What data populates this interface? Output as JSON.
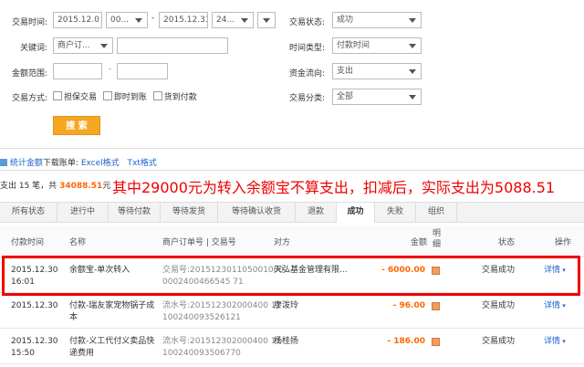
{
  "filters": {
    "time_label": "交易时间:",
    "start_date": "2015.12.0",
    "start_hour": "00...",
    "range_sep": "-",
    "end_date": "2015.12.31",
    "end_hour": "24...",
    "keyword_label": "关键词:",
    "keyword_type": "商户订...",
    "keyword_value": "",
    "amount_label": "金额范围:",
    "amount_from": "",
    "amount_sep": "-",
    "amount_to": "",
    "method_label": "交易方式:",
    "method_options": [
      "担保交易",
      "即时到账",
      "货到付款"
    ],
    "status_label": "交易状态:",
    "status_value": "成功",
    "time_type_label": "时间类型:",
    "time_type_value": "付款时间",
    "fund_flow_label": "资金流向:",
    "fund_flow_value": "支出",
    "category_label": "交易分类:",
    "category_value": "全部",
    "search_button": "搜 索"
  },
  "download": {
    "stats_link": "统计金额",
    "prefix": "下载账单:",
    "excel": "Excel格式",
    "txt": "Txt格式"
  },
  "summary": {
    "prefix": "支出 15 笔，共",
    "amount": "34088.51",
    "unit": "元",
    "annotation": "其中29000元为转入余额宝不算支出，扣减后，实际支出为5088.51"
  },
  "tabs": [
    "所有状态",
    "进行中",
    "等待付款",
    "等待发货",
    "等待确认收货",
    "退款",
    "成功",
    "失败",
    "组织"
  ],
  "active_tab": "成功",
  "table": {
    "headers": {
      "time": "付款时间",
      "name": "名称",
      "order": "商户订单号 | 交易号",
      "party": "对方",
      "amount": "金额",
      "detail_col": "明细",
      "status": "状态",
      "action": "操作"
    },
    "rows": [
      {
        "date": "2015.12.30",
        "time": "16:01",
        "name1": "余额宝-单次转入",
        "name2": "",
        "order1": "交易号:201512301105001000",
        "order2": "0002400466545 71",
        "party": "天弘基金管理有限...",
        "amount": "- 6000.00",
        "status": "交易成功",
        "action": "详情"
      },
      {
        "date": "2015.12.30",
        "time": "",
        "name1": "付款-瑞友家宠物锅子成",
        "name2": "本",
        "order1": "流水号:201512302000400 11",
        "order2": "100240093526121",
        "party": "廖泼玲",
        "amount": "- 96.00",
        "status": "交易成功",
        "action": "详情"
      },
      {
        "date": "2015.12.30",
        "time": "15:50",
        "name1": "付款-义工代付义卖品快",
        "name2": "递费用",
        "order1": "流水号:201512302000400 11",
        "order2": "100240093506770",
        "party": "杨桂扬",
        "amount": "- 186.00",
        "status": "交易成功",
        "action": "详情"
      }
    ]
  },
  "colors": {
    "accent_orange": "#f5a623",
    "highlight_red": "#e00000",
    "link_blue": "#1a63c8"
  }
}
